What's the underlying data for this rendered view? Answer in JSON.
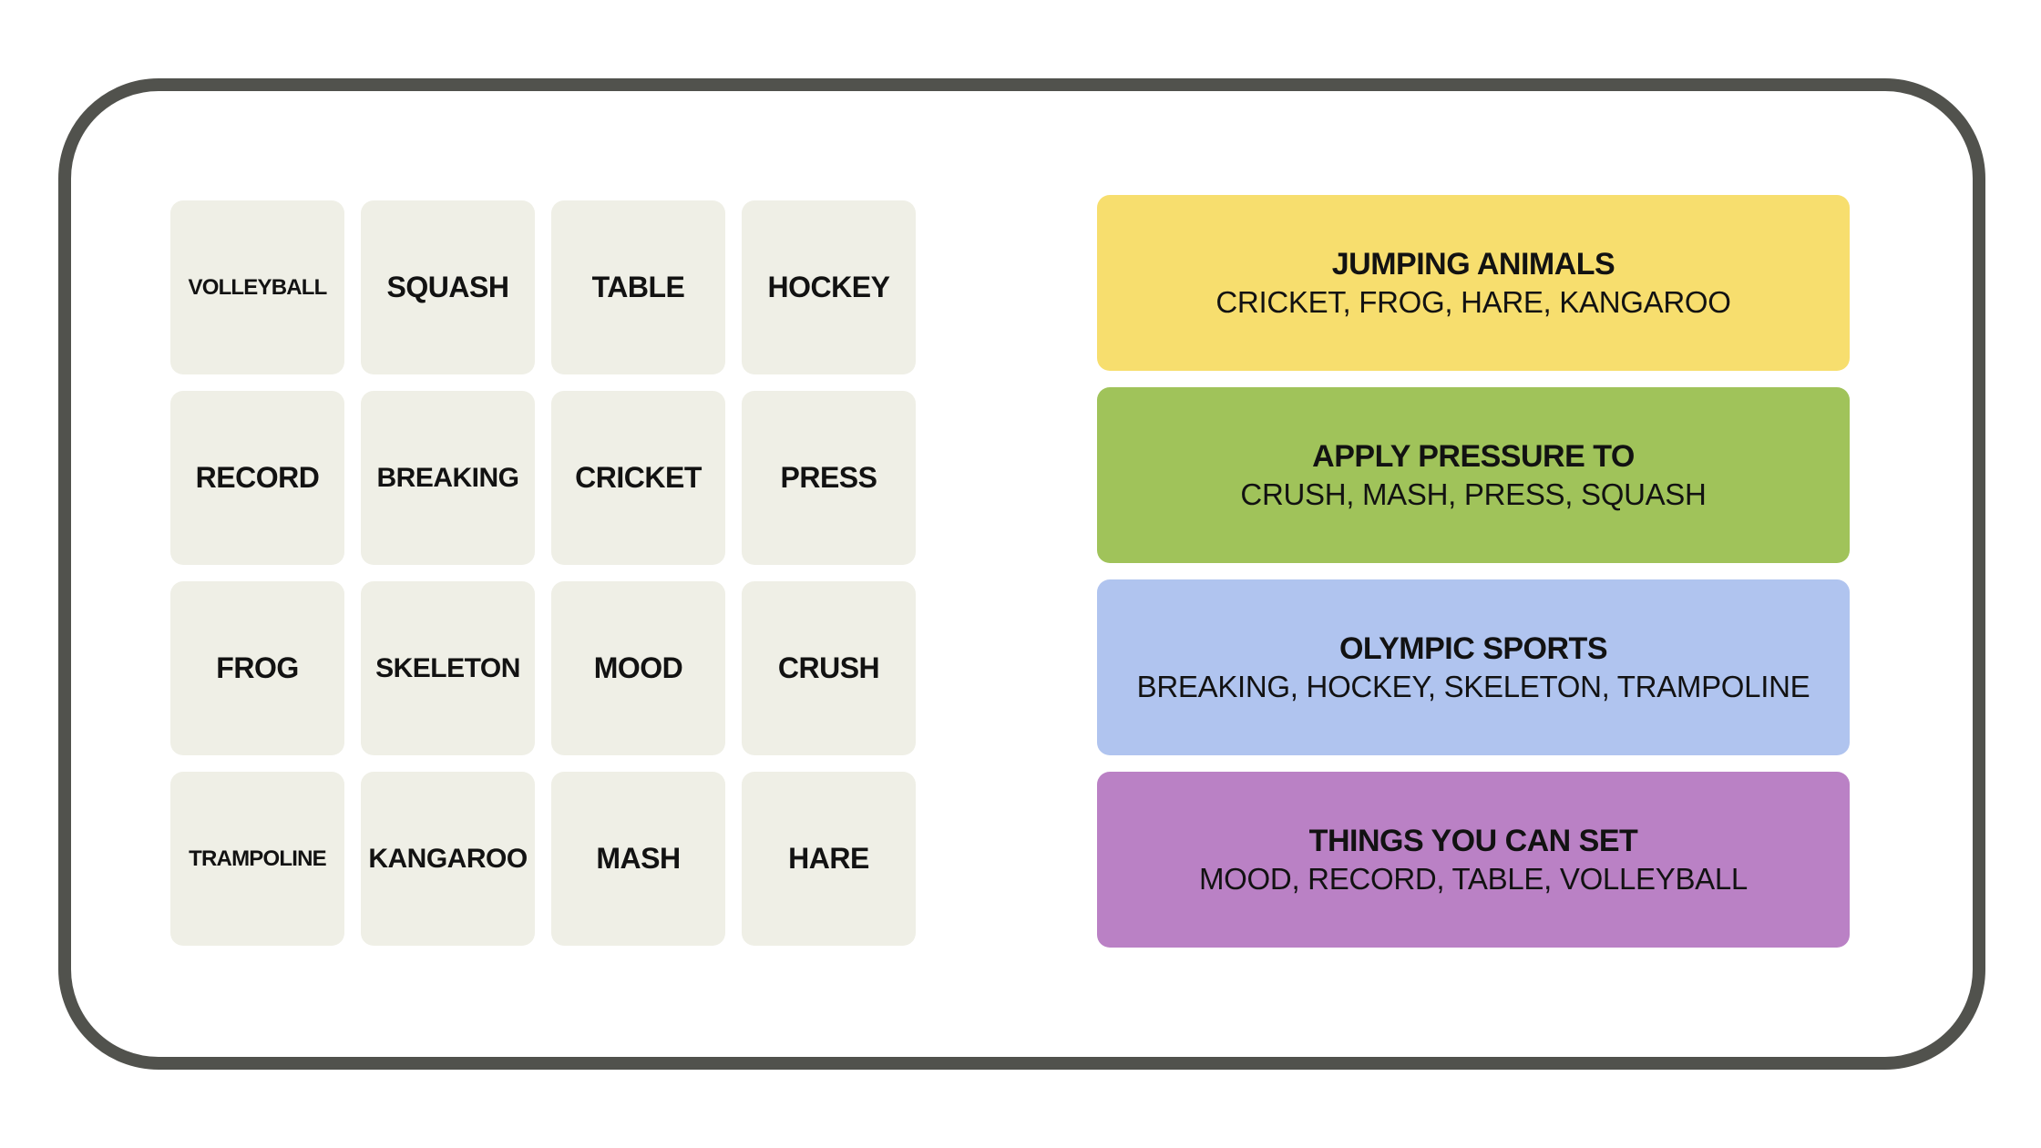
{
  "board": {
    "tiles": [
      [
        "VOLLEYBALL",
        "SQUASH",
        "TABLE",
        "HOCKEY"
      ],
      [
        "RECORD",
        "BREAKING",
        "CRICKET",
        "PRESS"
      ],
      [
        "FROG",
        "SKELETON",
        "MOOD",
        "CRUSH"
      ],
      [
        "TRAMPOLINE",
        "KANGAROO",
        "MASH",
        "HARE"
      ]
    ]
  },
  "solutions": [
    {
      "title": "JUMPING ANIMALS",
      "members": "CRICKET, FROG, HARE, KANGAROO",
      "color": "#f7de6e"
    },
    {
      "title": "APPLY PRESSURE TO",
      "members": "CRUSH, MASH, PRESS, SQUASH",
      "color": "#a0c35a"
    },
    {
      "title": "OLYMPIC SPORTS",
      "members": "BREAKING, HOCKEY, SKELETON, TRAMPOLINE",
      "color": "#b0c4ef"
    },
    {
      "title": "THINGS YOU CAN SET",
      "members": "MOOD, RECORD, TABLE, VOLLEYBALL",
      "color": "#ba81c5"
    }
  ],
  "colors": {
    "tile_bg": "#efefe6",
    "frame_border": "#51524d"
  }
}
